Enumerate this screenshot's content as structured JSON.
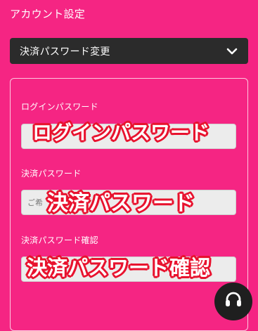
{
  "header": {
    "title": "アカウント設定"
  },
  "menu": {
    "selected": "決済パスワード変更",
    "icon": "chevron-down-icon"
  },
  "form": {
    "login_password": {
      "label": "ログインパスワード",
      "placeholder": "",
      "caption": "ログインパスワード"
    },
    "payment_password": {
      "label": "決済パスワード",
      "placeholder": "ご希",
      "caption": "決済パスワード"
    },
    "payment_password_confirm": {
      "label": "決済パスワード確認",
      "placeholder": "",
      "caption": "決済パスワード確認"
    }
  },
  "support": {
    "icon": "headset-icon"
  },
  "colors": {
    "background": "#f52583",
    "dropdown": "#2b2b2b",
    "input": "#ececec",
    "caption_outline": "#e8122e"
  }
}
